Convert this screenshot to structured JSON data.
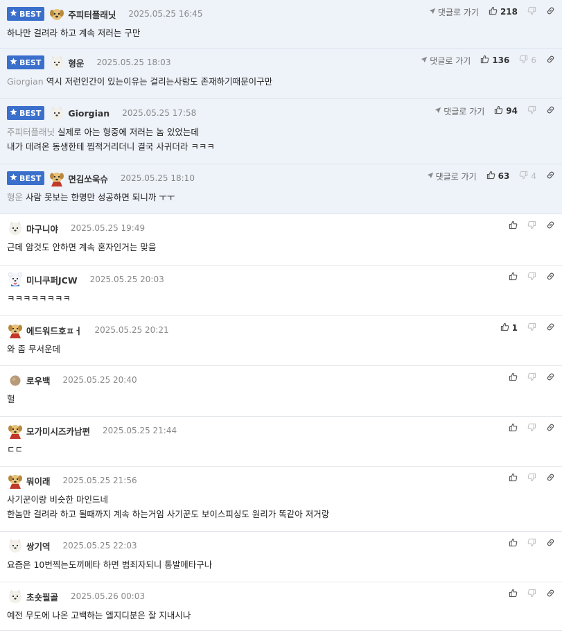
{
  "best_label": "BEST",
  "goto_label": "댓글로 가기",
  "comments": [
    {
      "best": true,
      "avatar": "puppy",
      "nick": "주피터플래닛",
      "date": "2025.05.25 16:45",
      "likes": "218",
      "dislikes": "",
      "mention": "",
      "lines": [
        "하나만 걸려라 하고 계속 저러는 구만"
      ]
    },
    {
      "best": true,
      "avatar": "samoyed",
      "nick": "형운",
      "date": "2025.05.25 18:03",
      "likes": "136",
      "dislikes": "6",
      "mention": "Giorgian",
      "lines": [
        "역시 저런인간이 있는이유는 걸리는사람도 존재하기때문이구만"
      ]
    },
    {
      "best": true,
      "avatar": "samoyed",
      "nick": "Giorgian",
      "date": "2025.05.25 17:58",
      "likes": "94",
      "dislikes": "",
      "mention": "주피터플래닛",
      "lines": [
        "실제로 아는 형중에 저러는 놈 있었는데",
        "내가 데려온 동생한테 찝적거리더니 결국 사귀더라 ㅋㅋㅋ"
      ]
    },
    {
      "best": true,
      "avatar": "puppy-red",
      "nick": "면김쏘욱슈",
      "date": "2025.05.25 18:10",
      "likes": "63",
      "dislikes": "4",
      "mention": "형운",
      "lines": [
        "사람 못보는 한명만 성공하면 되니까 ㅜㅜ"
      ]
    },
    {
      "best": false,
      "avatar": "samoyed",
      "nick": "마구니야",
      "date": "2025.05.25 19:49",
      "likes": "",
      "dislikes": "",
      "mention": "",
      "lines": [
        "근데 암것도 안하면 계속 혼자인거는 맞음"
      ]
    },
    {
      "best": false,
      "avatar": "bear",
      "nick": "미니쿠퍼JCW",
      "date": "2025.05.25 20:03",
      "likes": "",
      "dislikes": "",
      "mention": "",
      "lines": [
        "ㅋㅋㅋㅋㅋㅋㅋㅋ"
      ]
    },
    {
      "best": false,
      "avatar": "puppy-red",
      "nick": "에드워드호ㅍㅓ",
      "date": "2025.05.25 20:21",
      "likes": "1",
      "dislikes": "",
      "mention": "",
      "lines": [
        "와 좀 무서운데"
      ]
    },
    {
      "best": false,
      "avatar": "ball",
      "nick": "로우백",
      "date": "2025.05.25 20:40",
      "likes": "",
      "dislikes": "",
      "mention": "",
      "lines": [
        "헐"
      ]
    },
    {
      "best": false,
      "avatar": "puppy-red",
      "nick": "모가미시즈카남편",
      "date": "2025.05.25 21:44",
      "likes": "",
      "dislikes": "",
      "mention": "",
      "lines": [
        "ㄷㄷ"
      ]
    },
    {
      "best": false,
      "avatar": "puppy-red",
      "nick": "뭐이래",
      "date": "2025.05.25 21:56",
      "likes": "",
      "dislikes": "",
      "mention": "",
      "lines": [
        "사기꾼이랑 비슷한 마인드네",
        "한놈만 걸려라 하고 될때까지 계속 하는거임 사기꾼도 보이스피싱도 원리가 똑같아 저거랑"
      ]
    },
    {
      "best": false,
      "avatar": "samoyed",
      "nick": "쌍기역",
      "date": "2025.05.25 22:03",
      "likes": "",
      "dislikes": "",
      "mention": "",
      "lines": [
        "요즘은 10번찍는도끼메타 하면 범죄자되니 통발메타구나"
      ]
    },
    {
      "best": false,
      "avatar": "samoyed",
      "nick": "초숏필골",
      "date": "2025.05.26 00:03",
      "likes": "",
      "dislikes": "",
      "mention": "",
      "lines": [
        "예전 무도에 나온 고백하는 엘지디분은 잘 지내시나"
      ]
    }
  ]
}
